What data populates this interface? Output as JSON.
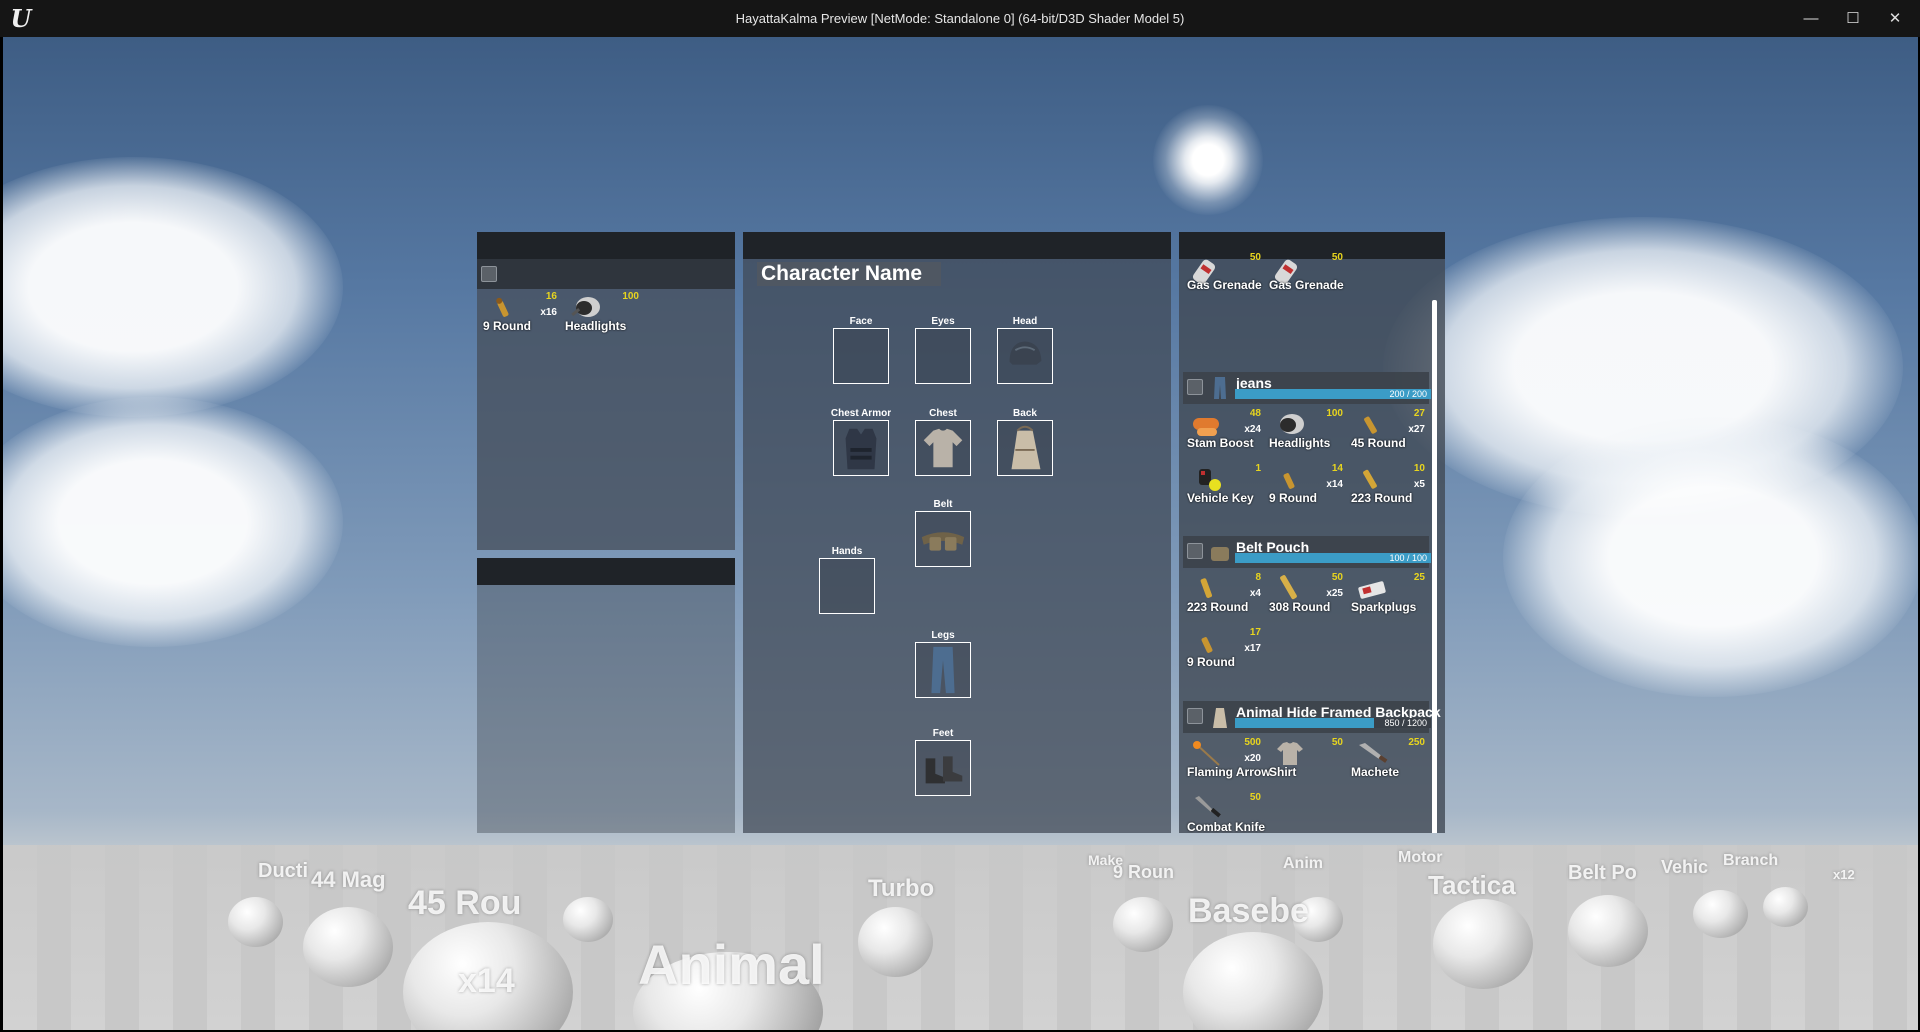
{
  "window": {
    "title": "HayattaKalma Preview [NetMode: Standalone 0]  (64-bit/D3D Shader Model 5)",
    "logo": "U"
  },
  "controls": {
    "minimize": "—",
    "maximize": "☐",
    "close": "✕"
  },
  "ground_container": {
    "items": [
      {
        "name": "9 Round",
        "value": "16",
        "qty": "x16",
        "icon": "bullet-icon"
      },
      {
        "name": "Headlights",
        "value": "100",
        "qty": "",
        "icon": "headlights-icon"
      }
    ]
  },
  "character": {
    "name": "Character Name",
    "slots": {
      "face": "Face",
      "eyes": "Eyes",
      "head": "Head",
      "chest_armor": "Chest Armor",
      "chest": "Chest",
      "back": "Back",
      "belt": "Belt",
      "hands": "Hands",
      "legs": "Legs",
      "feet": "Feet"
    }
  },
  "inventory": {
    "top_items": [
      {
        "name": "Gas Grenade",
        "value": "50"
      },
      {
        "name": "Gas Grenade",
        "value": "50"
      }
    ],
    "containers": [
      {
        "name": "jeans",
        "capacity": "200 / 200",
        "fill": 1.0,
        "items": [
          {
            "name": "Stam Boost",
            "value": "48",
            "qty": "x24"
          },
          {
            "name": "Headlights",
            "value": "100",
            "qty": ""
          },
          {
            "name": "45 Round",
            "value": "27",
            "qty": "x27"
          },
          {
            "name": "Vehicle Key",
            "value": "1",
            "qty": ""
          },
          {
            "name": "9 Round",
            "value": "14",
            "qty": "x14"
          },
          {
            "name": "223 Round",
            "value": "10",
            "qty": "x5"
          }
        ]
      },
      {
        "name": "Belt Pouch",
        "capacity": "100 / 100",
        "fill": 1.0,
        "items": [
          {
            "name": "223 Round",
            "value": "8",
            "qty": "x4"
          },
          {
            "name": "308 Round",
            "value": "50",
            "qty": "x25"
          },
          {
            "name": "Sparkplugs",
            "value": "25",
            "qty": ""
          },
          {
            "name": "9 Round",
            "value": "17",
            "qty": "x17"
          }
        ]
      },
      {
        "name": "Animal Hide Framed Backpack",
        "capacity": "850 / 1200",
        "fill": 0.708,
        "items": [
          {
            "name": "Flaming Arrow",
            "value": "500",
            "qty": "x20"
          },
          {
            "name": "Shirt",
            "value": "50",
            "qty": ""
          },
          {
            "name": "Machete",
            "value": "250",
            "qty": ""
          },
          {
            "name": "Combat Knife",
            "value": "50",
            "qty": ""
          }
        ]
      }
    ]
  },
  "world_labels": [
    "Animal",
    "45 Rou",
    "x14",
    "Basebe",
    "Tactica",
    "Turbo",
    "44 Mag",
    "Ducti",
    "Belt Po",
    "Vehic",
    "Branch",
    "x12",
    "Motor",
    "9 Roun",
    "Anim",
    "Make"
  ],
  "colors": {
    "value": "#e8d51e",
    "bar": "#3b9cc6",
    "header": "#1f2328"
  }
}
